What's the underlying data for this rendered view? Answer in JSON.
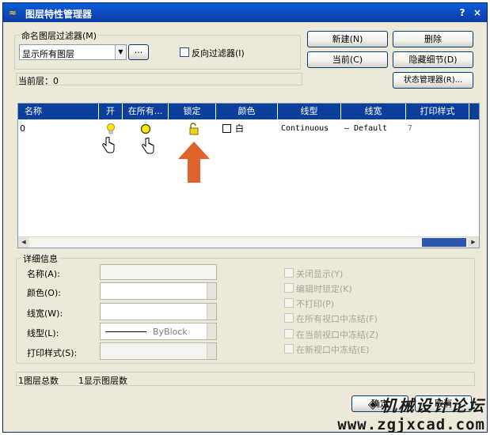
{
  "window": {
    "title": "图层特性管理器",
    "help": "?",
    "close": "×"
  },
  "filter": {
    "group_label": "命名图层过滤器(M)",
    "selected": "显示所有图层",
    "browse": "...",
    "invert_label": "反向过滤器(I)"
  },
  "buttons": {
    "new": "新建(N)",
    "delete": "删除",
    "current": "当前(C)",
    "hide_details": "隐藏细节(D)",
    "state_manager": "状态管理器(R)...",
    "ok": "确定",
    "cancel": "取消"
  },
  "current_layer": "当前层：0",
  "columns": [
    "名称",
    "开",
    "在所有...",
    "锁定",
    "颜色",
    "线型",
    "线宽",
    "打印样式"
  ],
  "rows": [
    {
      "name": "0",
      "color": "白",
      "linetype": "Continuous",
      "lineweight": "— Default",
      "plotstyle": "7"
    }
  ],
  "details": {
    "group_label": "详细信息",
    "name_label": "名称(A):",
    "color_label": "颜色(O):",
    "lineweight_label": "线宽(W):",
    "linetype_label": "线型(L):",
    "linetype_value": "ByBlock",
    "plotstyle_label": "打印样式(S):",
    "options": [
      "关闭显示(Y)",
      "编辑时锁定(K)",
      "不打印(P)",
      "在所有视口中冻结(F)",
      "在当前视口中冻结(Z)",
      "在新视口中冻结(E)"
    ]
  },
  "status": {
    "total": "1图层总数",
    "shown": "1显示图层数"
  },
  "watermark": {
    "name": "机械设计论坛",
    "url": "www.zgjxcad.com"
  },
  "colors": {
    "title_bar": "#0b4bc4",
    "header": "#0c3f9c",
    "arrow": "#e0622d",
    "bulb": "#ffe21a"
  }
}
